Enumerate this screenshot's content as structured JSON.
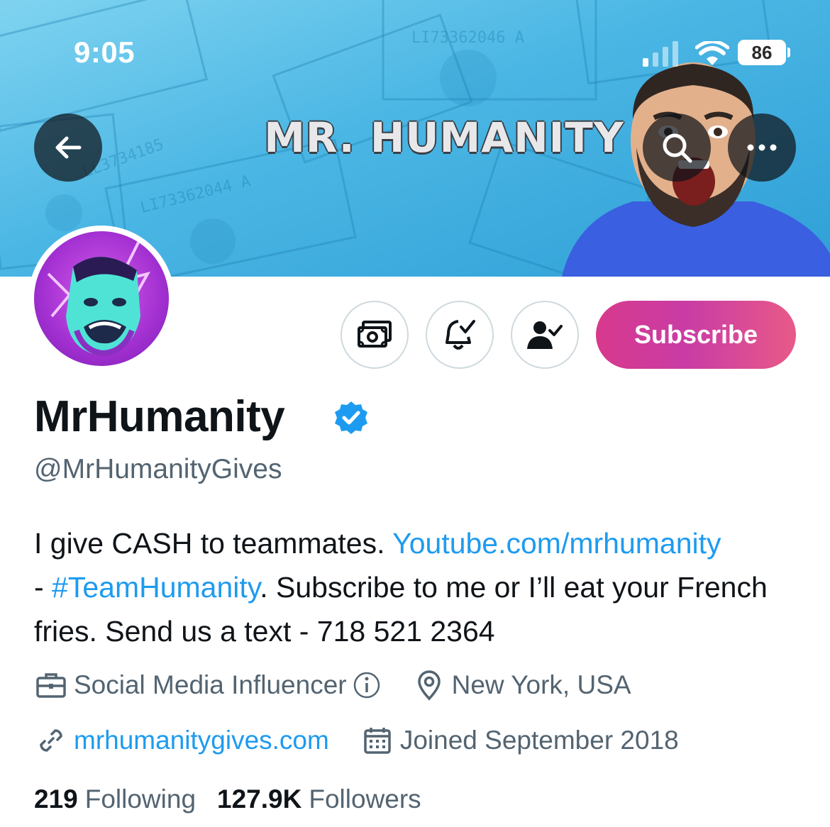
{
  "status_bar": {
    "time": "9:05",
    "battery": "86"
  },
  "banner": {
    "title": "MR. HUMANITY"
  },
  "icons": {
    "back": "arrow-left-icon",
    "search": "search-icon",
    "more": "more-horizontal-icon",
    "tip": "money-icon",
    "notifications": "bell-check-icon",
    "following": "person-check-icon",
    "verified": "verified-badge-icon",
    "professional_category": "briefcase-icon",
    "info": "info-icon",
    "location": "location-pin-icon",
    "url": "link-icon",
    "join_date": "calendar-icon"
  },
  "colors": {
    "link": "#1d9bf0",
    "secondary_text": "#536471",
    "primary_text": "#0f1419",
    "subscribe_gradient_start": "#d7398c",
    "subscribe_gradient_end": "#e85a87"
  },
  "actions": {
    "subscribe_label": "Subscribe"
  },
  "profile": {
    "display_name": "MrHumanity",
    "handle": "@MrHumanityGives",
    "bio": {
      "part1": "I give CASH to teammates. ",
      "link1": "Youtube.com/mrhumanity",
      "part2": " - ",
      "hashtag": "#TeamHumanity",
      "part3": ". Subscribe to me or I’ll eat your French fries. Send us a text - 718 521 2364"
    },
    "category": "Social Media Influencer",
    "location": "New York, USA",
    "website": "mrhumanitygives.com",
    "joined": "Joined September 2018",
    "following_count": "219",
    "following_label": "Following",
    "followers_count": "127.9K",
    "followers_label": "Followers"
  }
}
